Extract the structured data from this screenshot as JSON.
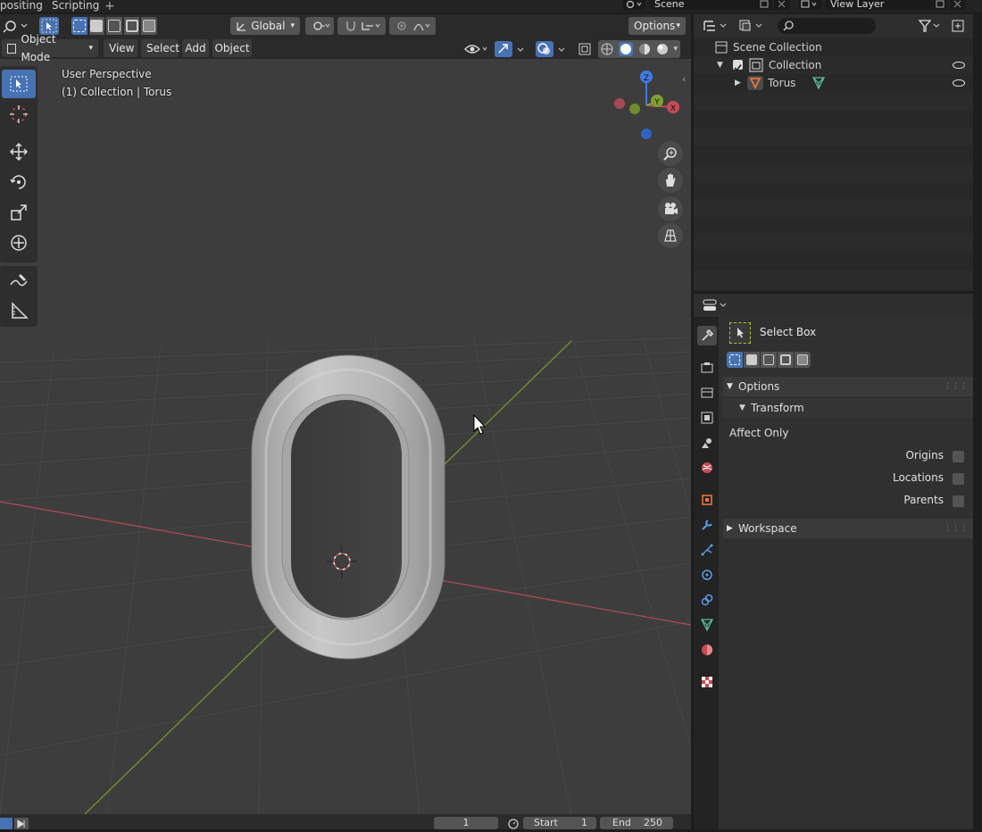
{
  "workspace_tabs": {
    "compositing": "positing",
    "scripting": "Scripting",
    "add": "+"
  },
  "top_fields": {
    "scene": "Scene",
    "view_layer": "View Layer"
  },
  "viewport_header": {
    "transform_orientation": "Global",
    "options_label": "Options",
    "mode": "Object Mode",
    "menus": {
      "view": "View",
      "select": "Select",
      "add": "Add",
      "object": "Object"
    }
  },
  "viewport_overlay": {
    "perspective": "User Perspective",
    "collection_info": "(1) Collection | Torus"
  },
  "gizmo": {
    "z": "Z",
    "y": "Y",
    "x": "X"
  },
  "timeline": {
    "current_frame": "1",
    "start_label": "Start",
    "start_value": "1",
    "end_label": "End",
    "end_value": "250"
  },
  "outliner": {
    "search_placeholder": "",
    "rows": {
      "scene_collection": "Scene Collection",
      "collection": "Collection",
      "torus": "Torus"
    }
  },
  "properties": {
    "tool_name": "Select Box",
    "options_panel": "Options",
    "transform_subpanel": "Transform",
    "affect_only": "Affect Only",
    "origins": "Origins",
    "locations": "Locations",
    "parents": "Parents",
    "workspace_panel": "Workspace"
  },
  "colors": {
    "accent": "#4772b3",
    "x_axis": "#c64b55",
    "y_axis": "#7da12f",
    "z_axis": "#3e7be4",
    "viewport_bg": "#3d3d3d"
  },
  "icons": [
    "editor-type-icon",
    "select-box-icon",
    "transform-pivot-icon",
    "snap-icon",
    "proportional-edit-icon",
    "eye-icon",
    "zoom-icon",
    "hand-icon",
    "camera-icon",
    "grid-icon",
    "move-icon",
    "rotate-icon",
    "scale-icon",
    "transform-icon",
    "annotate-icon",
    "measure-icon",
    "filter-icon",
    "torus-mesh-icon"
  ]
}
